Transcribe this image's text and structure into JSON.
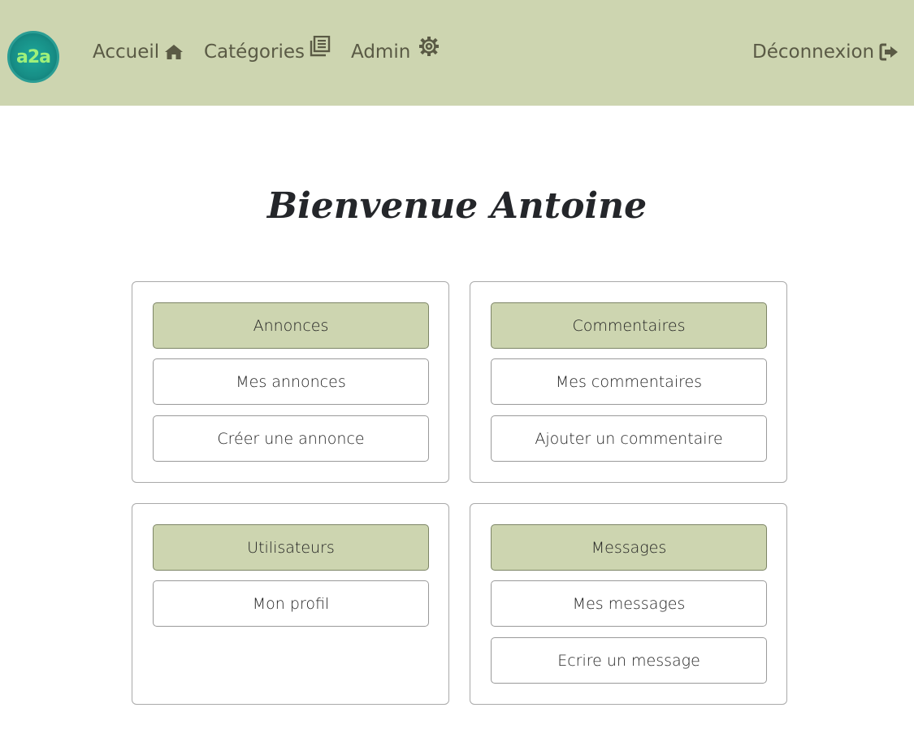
{
  "nav": {
    "logo_text": "a2a",
    "accueil": "Accueil",
    "categories": "Catégories",
    "admin": "Admin",
    "logout": "Déconnexion",
    "icons": [
      "home-icon",
      "categories-icon",
      "gear-icon",
      "logout-icon"
    ]
  },
  "welcome": "Bienvenue Antoine",
  "cards": {
    "annonces": {
      "header": "Annonces",
      "items": [
        "Mes annonces",
        "Créer une annonce"
      ]
    },
    "commentaires": {
      "header": "Commentaires",
      "items": [
        "Mes commentaires",
        "Ajouter un commentaire"
      ]
    },
    "utilisateurs": {
      "header": "Utilisateurs",
      "items": [
        "Mon profil"
      ]
    },
    "messages": {
      "header": "Messages",
      "items": [
        "Mes messages",
        "Ecrire un message"
      ]
    }
  },
  "colors": {
    "nav_bg": "#cdd5b0",
    "nav_text": "#5a5a45",
    "header_btn_bg": "#cdd5b0",
    "logo_bg": "#178e86"
  }
}
